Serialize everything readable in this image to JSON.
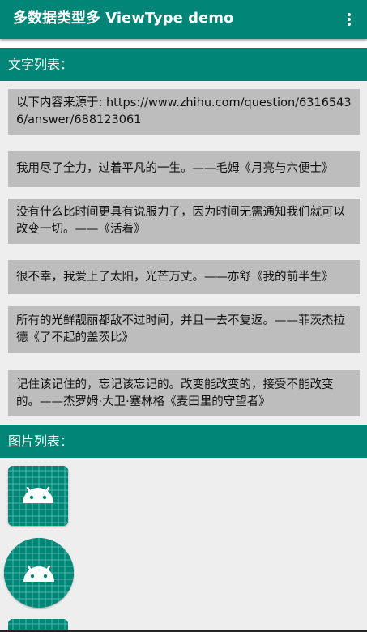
{
  "appbar": {
    "title": "多数据类型多 ViewType demo",
    "menu_icon": "more-vert-icon"
  },
  "text_section": {
    "header": "文字列表："
  },
  "text_items": [
    "以下内容来源于: https://www.zhihu.com/question/63165436/answer/688123061",
    "我用尽了全力，过着平凡的一生。——毛姆《月亮与六便士》",
    "没有什么比时间更具有说服力了，因为时间无需通知我们就可以改变一切。——《活着》",
    "很不幸，我爱上了太阳，光芒万丈。——亦舒《我的前半生》",
    "所有的光鲜靓丽都敌不过时间，并且一去不复返。——菲茨杰拉德《了不起的盖茨比》",
    "记住该记住的，忘记该忘记的。改变能改变的，接受不能改变的。——杰罗姆·大卫·塞林格《麦田里的守望者》"
  ],
  "image_section": {
    "header": "图片列表："
  },
  "image_items": [
    {
      "icon": "android-launcher-icon",
      "shape": "rounded-square"
    },
    {
      "icon": "android-launcher-icon",
      "shape": "circle"
    },
    {
      "icon": "android-launcher-icon",
      "shape": "rounded-square"
    }
  ],
  "colors": {
    "primary": "#008577",
    "item_background": "#bdbdbd",
    "page_background": "#eeeeee",
    "icon_grid": "#4db6ac"
  }
}
